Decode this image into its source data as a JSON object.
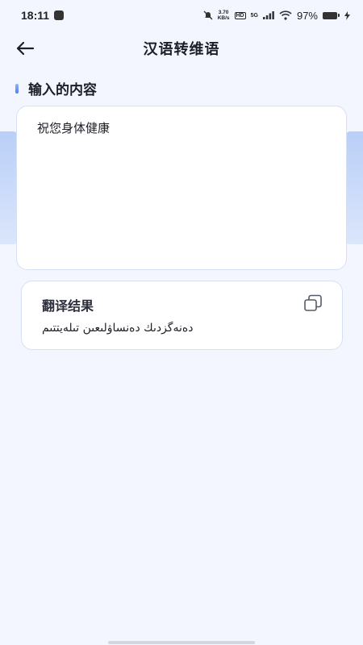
{
  "status_bar": {
    "time": "18:11",
    "net_speed_value": "3.70",
    "net_speed_unit": "KB/s",
    "hd_label": "HD",
    "network_label": "5G",
    "battery": "97%"
  },
  "header": {
    "title": "汉语转维语"
  },
  "input_section": {
    "title": "输入的内容",
    "text": "祝您身体健康"
  },
  "result_section": {
    "title": "翻译结果",
    "text": "دەنەگزدىك دەنساۋلىعىن تىلەيتتىم"
  },
  "icons": {
    "back": "arrow-left-icon",
    "copy": "copy-icon"
  },
  "colors": {
    "accent": "#4f7ef6",
    "background": "#f3f6ff",
    "card_border": "#d6e0f5"
  }
}
